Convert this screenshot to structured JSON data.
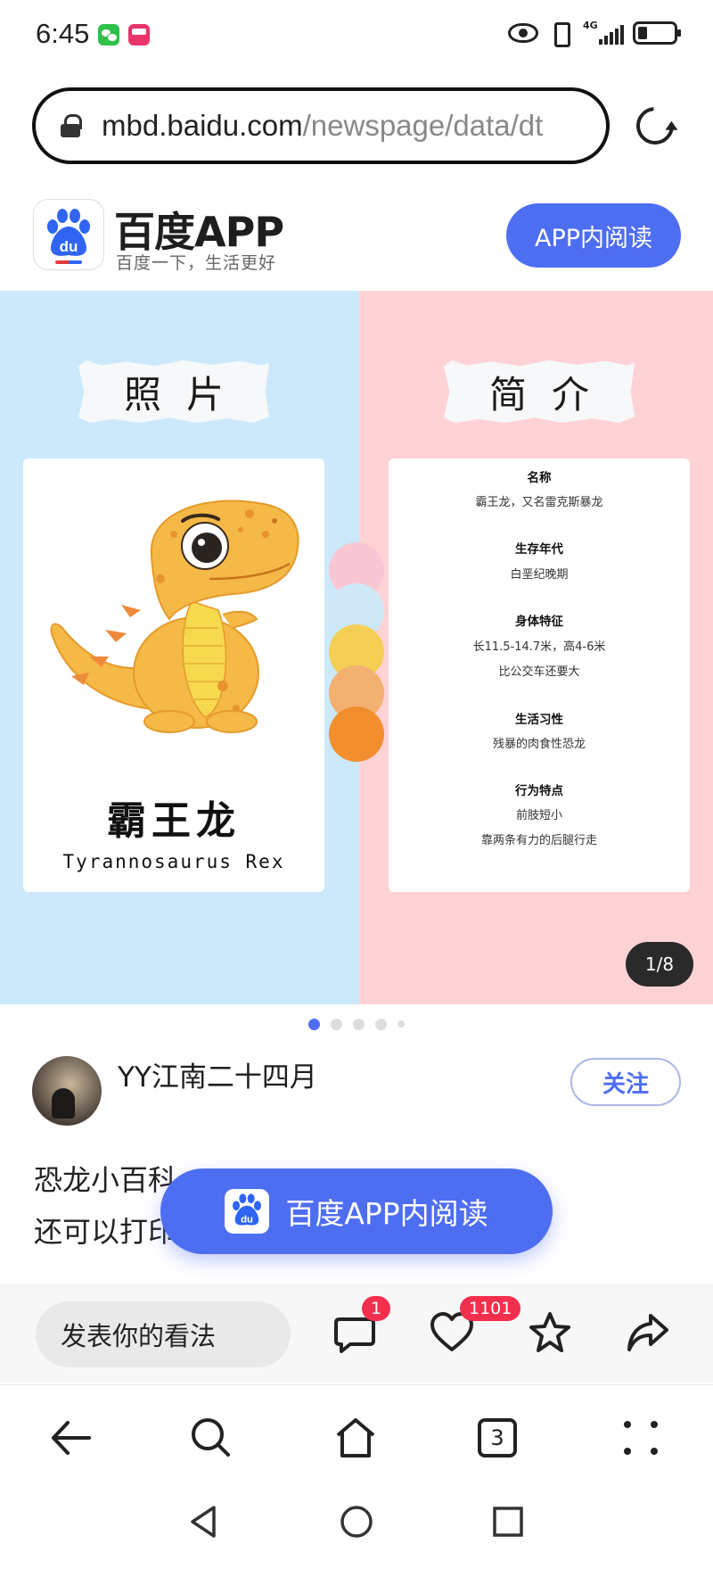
{
  "status_bar": {
    "time": "6:45",
    "network_label": "4G"
  },
  "url_bar": {
    "host": "mbd.baidu.com",
    "path": "/newspage/data/dt"
  },
  "app_header": {
    "app_name": "百度APP",
    "slogan": "百度一下，生活更好",
    "read_button": "APP内阅读",
    "logo_text": "du"
  },
  "carousel": {
    "label_photo": "照片",
    "label_intro": "简介",
    "dino_name_cn": "霸王龙",
    "dino_name_en": "Tyrannosaurus Rex",
    "info": [
      {
        "head": "名称",
        "lines": [
          "霸王龙，又名雷克斯暴龙"
        ]
      },
      {
        "head": "生存年代",
        "lines": [
          "白垩纪晚期"
        ]
      },
      {
        "head": "身体特征",
        "lines": [
          "长11.5-14.7米，高4-6米",
          "比公交车还要大"
        ]
      },
      {
        "head": "生活习性",
        "lines": [
          "残暴的肉食性恐龙"
        ]
      },
      {
        "head": "行为特点",
        "lines": [
          "前肢短小",
          "靠两条有力的后腿行走"
        ]
      }
    ],
    "palette": [
      "#f9c7d3",
      "#cfe8f6",
      "#f5cf55",
      "#f2b071",
      "#f28e2e"
    ],
    "page_counter": "1/8",
    "dot_count": 5,
    "active_dot": 0
  },
  "author": {
    "name": "YY江南二十四月",
    "follow_label": "关注"
  },
  "article": {
    "line1": "恐龙小百科",
    "line2": "还可以打印"
  },
  "float_button": {
    "label": "百度APP内阅读"
  },
  "action_bar": {
    "comment_placeholder": "发表你的看法",
    "comment_count": "1",
    "like_count": "1101"
  },
  "bottom_nav": {
    "tab_count": "3"
  },
  "colors": {
    "brand_blue": "#4e6ef2",
    "badge_red": "#f2304e",
    "panel_blue": "#cbe9fb",
    "panel_pink": "#ffd2d6"
  }
}
